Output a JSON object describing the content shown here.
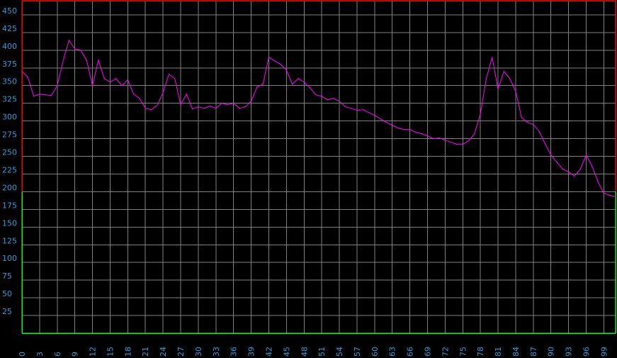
{
  "colors": {
    "background": "#000000",
    "grid": "#7f7f7f",
    "line": "#ff00ff",
    "tick_label": "#2aa0d8",
    "border_top": "#ff0000",
    "border_left_upper": "#ff0000",
    "border_lower": "#00ff00"
  },
  "chart_data": {
    "type": "line",
    "title": "",
    "xlabel": "",
    "ylabel": "",
    "xlim": [
      0,
      101
    ],
    "ylim": [
      0,
      470
    ],
    "grid": true,
    "y_ticks": [
      25,
      50,
      75,
      100,
      125,
      150,
      175,
      200,
      225,
      250,
      275,
      300,
      325,
      350,
      375,
      400,
      425,
      450
    ],
    "x_ticks": [
      0,
      3,
      6,
      9,
      12,
      15,
      18,
      21,
      24,
      27,
      30,
      33,
      36,
      39,
      42,
      45,
      48,
      51,
      54,
      57,
      60,
      63,
      66,
      69,
      72,
      75,
      78,
      81,
      84,
      87,
      90,
      93,
      96,
      99
    ],
    "threshold_value": 200,
    "series": [
      {
        "values": [
          370,
          362,
          335,
          338,
          337,
          336,
          350,
          385,
          414,
          402,
          400,
          386,
          350,
          386,
          360,
          355,
          360,
          350,
          358,
          338,
          332,
          318,
          316,
          322,
          340,
          366,
          360,
          323,
          338,
          317,
          320,
          318,
          321,
          318,
          325,
          323,
          325,
          318,
          320,
          328,
          348,
          352,
          390,
          385,
          380,
          372,
          352,
          360,
          355,
          347,
          337,
          335,
          330,
          332,
          328,
          320,
          318,
          315,
          316,
          312,
          308,
          303,
          298,
          294,
          290,
          288,
          288,
          284,
          282,
          279,
          275,
          276,
          273,
          270,
          267,
          267,
          272,
          282,
          310,
          360,
          390,
          345,
          370,
          360,
          342,
          305,
          298,
          295,
          285,
          268,
          252,
          242,
          232,
          228,
          222,
          232,
          252,
          236,
          214,
          198,
          195,
          193
        ]
      }
    ]
  }
}
